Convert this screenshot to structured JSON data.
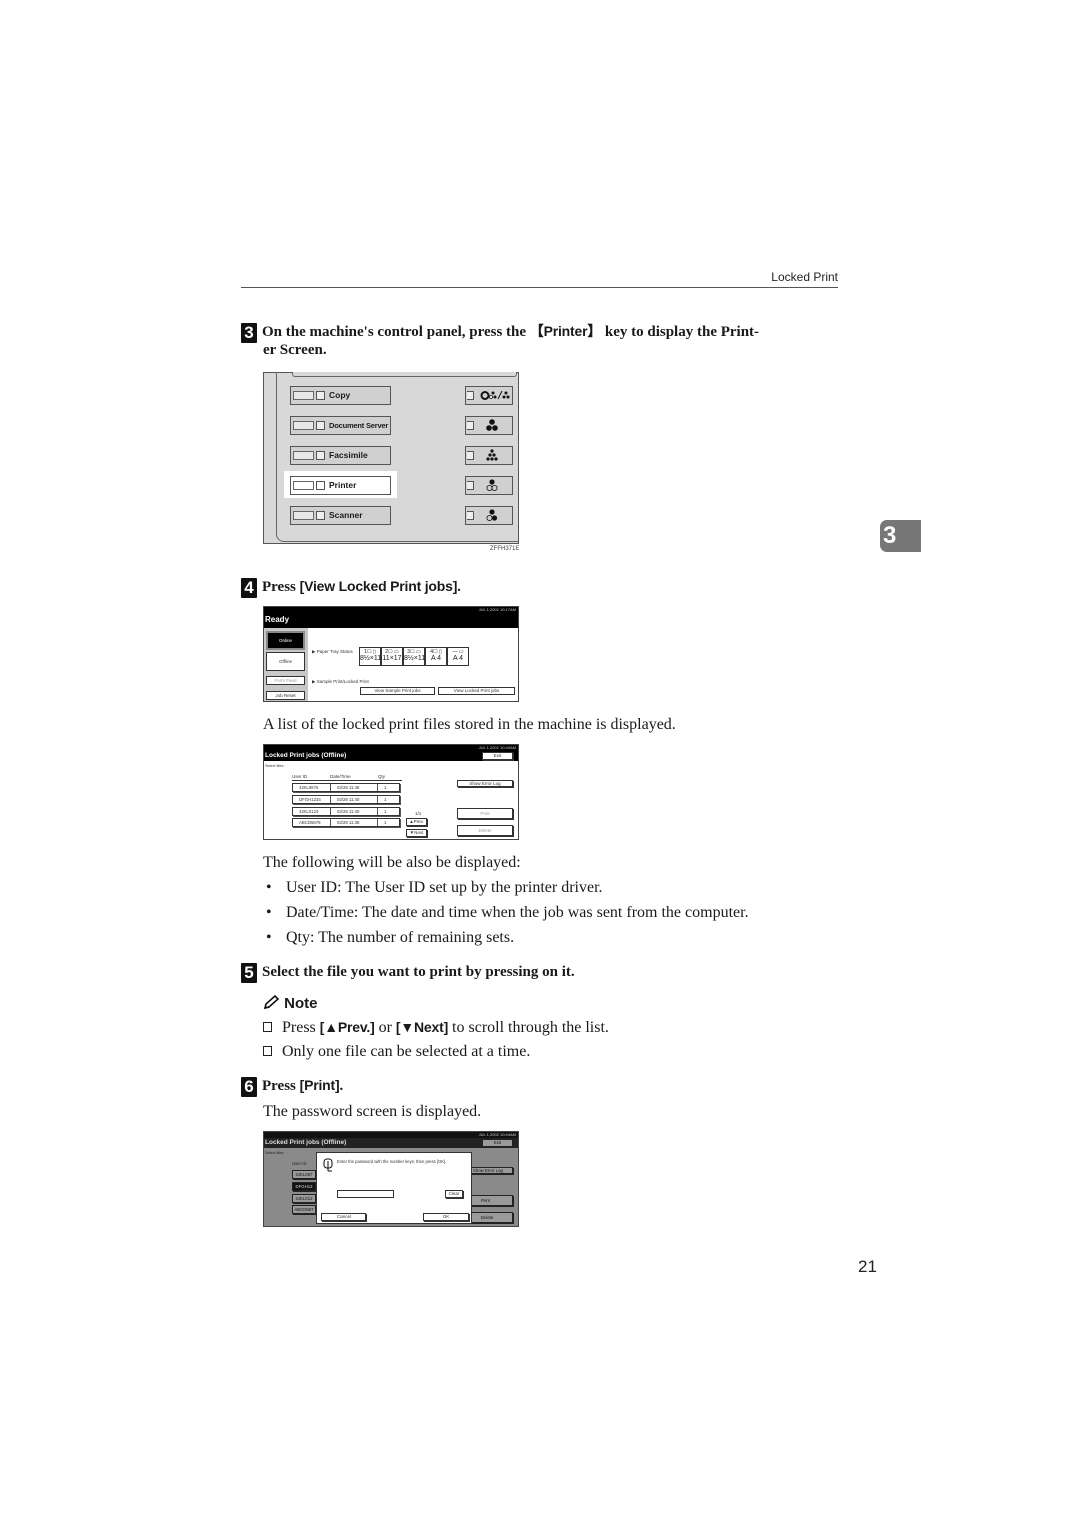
{
  "header": {
    "section_title": "Locked Print"
  },
  "chapter_tab": "3",
  "page_number": "21",
  "steps": {
    "s3": {
      "number": "3",
      "text_before": "On the machine's control panel, press the ",
      "key": "【Printer】",
      "text_after": " key to display the Print-",
      "continuation": "er Screen."
    },
    "s4": {
      "number": "4",
      "text": "Press ",
      "key": "[View Locked Print jobs]",
      "end": "."
    },
    "s5": {
      "number": "5",
      "text": "Select the file you want to print by pressing on it."
    },
    "s6": {
      "number": "6",
      "text": "Press ",
      "key": "[Print]",
      "end": "."
    }
  },
  "control_panel": {
    "mode_keys": [
      "Copy",
      "Document Server",
      "Facsimile",
      "Printer",
      "Scanner"
    ],
    "highlighted": "Printer",
    "function_icons": [
      "color-mode-icon",
      "full-color-icon",
      "four-color-icon",
      "black-icon",
      "two-color-icon"
    ],
    "figure_code": "ZFFH371E"
  },
  "ready_screen": {
    "status_bar": "JUL   1,2002 10:17AM",
    "title": "Ready",
    "left_buttons": [
      "Online",
      "Offline",
      "Form Feed",
      "Job Reset"
    ],
    "paper_tray_label": "▶ Paper Tray Status",
    "trays": [
      {
        "top": "1☐ ▯",
        "size": "8½×11"
      },
      {
        "top": "2☐ ▭",
        "size": "11×17"
      },
      {
        "top": "3☐ ▭",
        "size": "8½×11"
      },
      {
        "top": "4☐ ▯",
        "size": "A 4"
      },
      {
        "top": "— ▭",
        "size": "A 4"
      }
    ],
    "sample_label": "▶ Sample Print/Locked Print",
    "view_sample_button": "View Sample Print jobs",
    "view_locked_button": "View Locked Print jobs"
  },
  "intro_text": "A list of the locked print files stored in the machine is displayed.",
  "locked_screen": {
    "status_bar": "JUL   1,2002 10:40AM",
    "title": "Locked Print jobs (Offline)",
    "exit_button": "Exit",
    "select_label": "Select files.",
    "columns": [
      "User ID",
      "Date/Time",
      "Qty"
    ],
    "rows": [
      {
        "user": "3JKL0876",
        "datetime": "03/28  11:48",
        "qty": "1"
      },
      {
        "user": "DFGH1234",
        "datetime": "03/28  11:40",
        "qty": "1"
      },
      {
        "user": "3JKL0123",
        "datetime": "03/28  11:40",
        "qty": "1"
      },
      {
        "user": "ABCD5678",
        "datetime": "03/28  11:38",
        "qty": "1"
      }
    ],
    "page_indicator": "1/1",
    "prev_button": "▲Prev.",
    "next_button": "▼Next",
    "error_log_button": "Show Error Log",
    "print_button": "Print",
    "delete_button": "Delete"
  },
  "also_displayed": {
    "intro": "The following will be also be displayed:",
    "items": [
      "User ID: The User ID set up by the printer driver.",
      "Date/Time: The date and time when the job was sent from the computer.",
      "Qty: The number of remaining sets."
    ]
  },
  "note": {
    "title": "Note",
    "items": [
      {
        "before": "Press ",
        "k1": "[▲Prev.]",
        "mid": " or ",
        "k2": "[▼Next]",
        "after": " to scroll through the list."
      },
      {
        "before": "Only one file can be selected at a time."
      }
    ]
  },
  "password_text": "The password screen is displayed.",
  "password_screen": {
    "status_bar": "JUL   1,2002 10:44AM",
    "title": "Locked Print jobs (Offline)",
    "exit_button": "Exit",
    "select_label": "Select files.",
    "user_col": "User ID",
    "rows": [
      "3JKL087",
      "DFGH12",
      "3JKL012",
      "ABCD567"
    ],
    "dialog_message": "Enter the password with the number keys, then press [OK].",
    "password_value": "",
    "clear_button": "Clear",
    "cancel_button": "Cancel",
    "ok_button": "OK",
    "error_log_button": "Show Error Log",
    "print_button": "Print",
    "delete_button": "Delete"
  }
}
